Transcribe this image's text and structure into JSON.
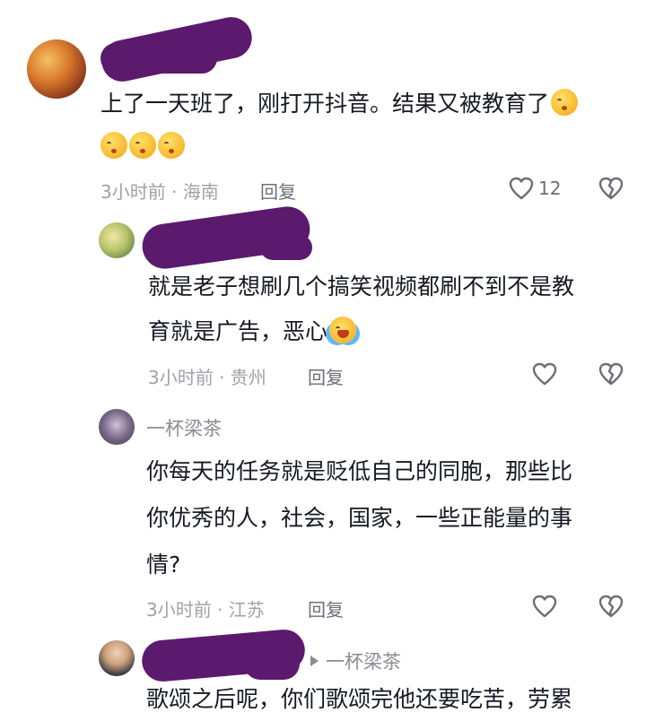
{
  "comments": [
    {
      "username_visible_suffix": "",
      "lines": [
        "上了一天班了，刚打开抖音。结果又被教育了"
      ],
      "emoji_line_count": 3,
      "meta": "3小时前 · 海南",
      "reply_label": "回复",
      "like_count": "12"
    },
    {
      "lines": [
        "就是老子想刷几个搞笑视频都刷不到不是教",
        "育就是广告，恶心"
      ],
      "meta": "3小时前 · 贵州",
      "reply_label": "回复"
    },
    {
      "username": "一杯梁茶",
      "lines": [
        "你每天的任务就是贬低自己的同胞，那些比",
        "你优秀的人，社会，国家，一些正能量的事",
        "情?"
      ],
      "meta": "3小时前 · 江苏",
      "reply_label": "回复"
    },
    {
      "reply_to": "一杯梁茶",
      "lines": [
        "歌颂之后呢，你们歌颂完他还要吃苦，劳累"
      ]
    }
  ],
  "icons": {
    "like": "heart-outline-icon",
    "dislike": "broken-heart-outline-icon"
  }
}
